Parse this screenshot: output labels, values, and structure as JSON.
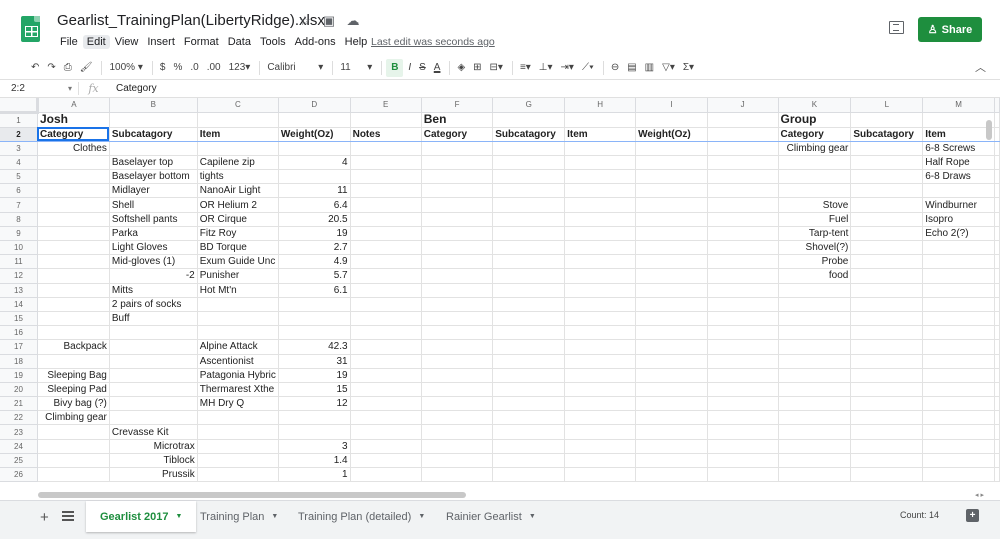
{
  "window": {
    "title": "Gearlist_TrainingPlan(LibertyRidge).xlsx",
    "last_edit": "Last edit was seconds ago",
    "share_label": "Share"
  },
  "menu": [
    "File",
    "Edit",
    "View",
    "Insert",
    "Format",
    "Data",
    "Tools",
    "Add-ons",
    "Help"
  ],
  "toolbar": {
    "zoom": "100%",
    "currency": "$",
    "percent": "%",
    "decimal_decrease": ".0",
    "decimal_increase": ".00",
    "more_formats": "123",
    "font": "Calibri",
    "font_size": "11",
    "bold": "B",
    "italic": "I",
    "strike": "S",
    "text_color": "A"
  },
  "formula_bar": {
    "cell_ref": "2:2",
    "fx": "fx",
    "value": "Category"
  },
  "columns": [
    "A",
    "B",
    "C",
    "D",
    "E",
    "F",
    "G",
    "H",
    "I",
    "J",
    "K",
    "L",
    "M"
  ],
  "rows": [
    {
      "n": "1",
      "cells": [
        "Josh",
        "",
        "",
        "",
        "",
        "Ben",
        "",
        "",
        "",
        "",
        "Group",
        "",
        ""
      ]
    },
    {
      "n": "2",
      "cells": [
        "Category",
        "Subcatagory",
        "Item",
        "Weight(Oz)",
        "Notes",
        "Category",
        "Subcatagory",
        "Item",
        "Weight(Oz)",
        "",
        "Category",
        "Subcatagory",
        "Item"
      ]
    },
    {
      "n": "3",
      "cells": [
        "Clothes",
        "",
        "",
        "",
        "",
        "",
        "",
        "",
        "",
        "",
        "Climbing gear",
        "",
        "6-8 Screws"
      ]
    },
    {
      "n": "4",
      "cells": [
        "",
        "Baselayer top",
        "Capilene zip",
        "4",
        "",
        "",
        "",
        "",
        "",
        "",
        "",
        "",
        "Half Rope"
      ]
    },
    {
      "n": "5",
      "cells": [
        "",
        "Baselayer bottom",
        "tights",
        "",
        "",
        "",
        "",
        "",
        "",
        "",
        "",
        "",
        "6-8 Draws"
      ]
    },
    {
      "n": "6",
      "cells": [
        "",
        "Midlayer",
        "NanoAir Light",
        "11",
        "",
        "",
        "",
        "",
        "",
        "",
        "",
        "",
        ""
      ]
    },
    {
      "n": "7",
      "cells": [
        "",
        "Shell",
        "OR Helium 2",
        "6.4",
        "",
        "",
        "",
        "",
        "",
        "",
        "Stove",
        "",
        "Windburner"
      ]
    },
    {
      "n": "8",
      "cells": [
        "",
        "Softshell pants",
        "OR Cirque",
        "20.5",
        "",
        "",
        "",
        "",
        "",
        "",
        "Fuel",
        "",
        "Isopro"
      ]
    },
    {
      "n": "9",
      "cells": [
        "",
        "Parka",
        "Fitz Roy",
        "19",
        "",
        "",
        "",
        "",
        "",
        "",
        "Tarp-tent",
        "",
        "Echo 2(?)"
      ]
    },
    {
      "n": "10",
      "cells": [
        "",
        "Light Gloves",
        "BD Torque",
        "2.7",
        "",
        "",
        "",
        "",
        "",
        "",
        "Shovel(?)",
        "",
        ""
      ]
    },
    {
      "n": "11",
      "cells": [
        "",
        "Mid-gloves (1)",
        "Exum Guide Unc",
        "4.9",
        "",
        "",
        "",
        "",
        "",
        "",
        "Probe",
        "",
        ""
      ]
    },
    {
      "n": "12",
      "cells": [
        "",
        "-2",
        "Punisher",
        "5.7",
        "",
        "",
        "",
        "",
        "",
        "",
        "food",
        "",
        ""
      ]
    },
    {
      "n": "13",
      "cells": [
        "",
        "Mitts",
        "Hot Mt'n",
        "6.1",
        "",
        "",
        "",
        "",
        "",
        "",
        "",
        "",
        ""
      ]
    },
    {
      "n": "14",
      "cells": [
        "",
        "2 pairs of socks",
        "",
        "",
        "",
        "",
        "",
        "",
        "",
        "",
        "",
        "",
        ""
      ]
    },
    {
      "n": "15",
      "cells": [
        "",
        "Buff",
        "",
        "",
        "",
        "",
        "",
        "",
        "",
        "",
        "",
        "",
        ""
      ]
    },
    {
      "n": "16",
      "cells": [
        "",
        "",
        "",
        "",
        "",
        "",
        "",
        "",
        "",
        "",
        "",
        "",
        ""
      ]
    },
    {
      "n": "17",
      "cells": [
        "Backpack",
        "",
        "Alpine Attack",
        "42.3",
        "",
        "",
        "",
        "",
        "",
        "",
        "",
        "",
        ""
      ]
    },
    {
      "n": "18",
      "cells": [
        "",
        "",
        "Ascentionist",
        "31",
        "",
        "",
        "",
        "",
        "",
        "",
        "",
        "",
        ""
      ]
    },
    {
      "n": "19",
      "cells": [
        "Sleeping Bag",
        "",
        "Patagonia Hybric",
        "19",
        "",
        "",
        "",
        "",
        "",
        "",
        "",
        "",
        ""
      ]
    },
    {
      "n": "20",
      "cells": [
        "Sleeping Pad",
        "",
        "Thermarest Xthe",
        "15",
        "",
        "",
        "",
        "",
        "",
        "",
        "",
        "",
        ""
      ]
    },
    {
      "n": "21",
      "cells": [
        "Bivy bag (?)",
        "",
        "MH Dry Q",
        "12",
        "",
        "",
        "",
        "",
        "",
        "",
        "",
        "",
        ""
      ]
    },
    {
      "n": "22",
      "cells": [
        "Climbing gear",
        "",
        "",
        "",
        "",
        "",
        "",
        "",
        "",
        "",
        "",
        "",
        ""
      ]
    },
    {
      "n": "23",
      "cells": [
        "",
        "Crevasse Kit",
        "",
        "",
        "",
        "",
        "",
        "",
        "",
        "",
        "",
        "",
        ""
      ]
    },
    {
      "n": "24",
      "cells": [
        "",
        "Microtrax",
        "",
        "3",
        "",
        "",
        "",
        "",
        "",
        "",
        "",
        "",
        ""
      ]
    },
    {
      "n": "25",
      "cells": [
        "",
        "Tiblock",
        "",
        "1.4",
        "",
        "",
        "",
        "",
        "",
        "",
        "",
        "",
        ""
      ]
    },
    {
      "n": "26",
      "cells": [
        "",
        "Prussik",
        "",
        "1",
        "",
        "",
        "",
        "",
        "",
        "",
        "",
        "",
        ""
      ]
    }
  ],
  "tabs": [
    {
      "label": "Gearlist 2017",
      "active": true
    },
    {
      "label": "Training Plan",
      "active": false
    },
    {
      "label": "Training Plan (detailed)",
      "active": false
    },
    {
      "label": "Rainier Gearlist",
      "active": false
    }
  ],
  "status": {
    "count": "Count: 14"
  },
  "colors": {
    "brand_green": "#1e8e3e",
    "selection_blue": "#1a73e8"
  }
}
